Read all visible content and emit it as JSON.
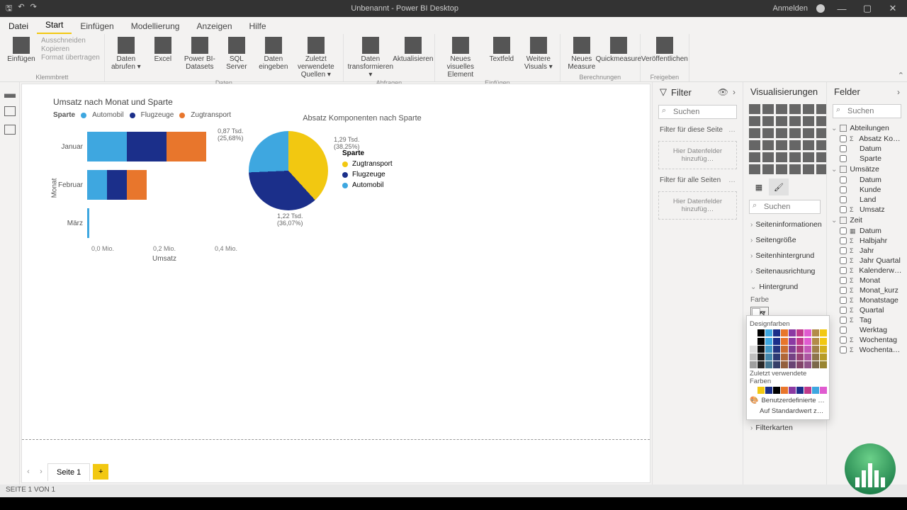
{
  "window": {
    "title": "Unbenannt - Power BI Desktop",
    "signin": "Anmelden"
  },
  "tabs": {
    "file": "Datei",
    "items": [
      "Start",
      "Einfügen",
      "Modellierung",
      "Anzeigen",
      "Hilfe"
    ],
    "active": 0
  },
  "ribbon": {
    "clipboard": {
      "label": "Klemmbrett",
      "paste": "Einfügen",
      "cut": "Ausschneiden",
      "copy": "Kopieren",
      "format": "Format übertragen"
    },
    "data": {
      "label": "Daten",
      "items": [
        "Daten abrufen ▾",
        "Excel",
        "Power BI-Datasets",
        "SQL Server",
        "Daten eingeben",
        "Zuletzt verwendete Quellen ▾"
      ]
    },
    "queries": {
      "label": "Abfragen",
      "items": [
        "Daten transformieren ▾",
        "Aktualisieren"
      ]
    },
    "insert": {
      "label": "Einfügen",
      "items": [
        "Neues visuelles Element",
        "Textfeld",
        "Weitere Visuals ▾"
      ]
    },
    "calc": {
      "label": "Berechnungen",
      "items": [
        "Neues Measure",
        "Quickmeasure"
      ]
    },
    "share": {
      "label": "Freigeben",
      "items": [
        "Veröffentlichen"
      ]
    }
  },
  "chart_data": [
    {
      "type": "stacked-bar",
      "title": "Umsatz nach Monat und Sparte",
      "legend_title": "Sparte",
      "xlabel": "Umsatz",
      "ylabel": "Monat",
      "xticks": [
        "0,0 Mio.",
        "0,2 Mio.",
        "0,4 Mio."
      ],
      "categories": [
        "Januar",
        "Februar",
        "März"
      ],
      "series": [
        {
          "name": "Automobil",
          "color": "#3ea7e0",
          "values": [
            0.12,
            0.05,
            0.01
          ]
        },
        {
          "name": "Flugzeuge",
          "color": "#1b2f8a",
          "values": [
            0.12,
            0.05,
            0.0
          ]
        },
        {
          "name": "Zugtransport",
          "color": "#e8762c",
          "values": [
            0.12,
            0.05,
            0.0
          ]
        }
      ]
    },
    {
      "type": "pie",
      "title": "Absatz Komponenten nach Sparte",
      "legend_title": "Sparte",
      "series": [
        {
          "name": "Zugtransport",
          "color": "#f2c811",
          "value": 1290,
          "label": "1,29 Tsd.",
          "pct": "(38,25%)"
        },
        {
          "name": "Flugzeuge",
          "color": "#1b2f8a",
          "value": 1220,
          "label": "1,22 Tsd.",
          "pct": "(36,07%)"
        },
        {
          "name": "Automobil",
          "color": "#3ea7e0",
          "value": 870,
          "label": "0,87 Tsd.",
          "pct": "(25,68%)"
        }
      ]
    }
  ],
  "pages": {
    "current": "Seite 1"
  },
  "filter": {
    "title": "Filter",
    "search": "Suchen",
    "page_label": "Filter für diese Seite",
    "all_label": "Filter für alle Seiten",
    "drop": "Hier Datenfelder hinzufüg…"
  },
  "vizpane": {
    "title": "Visualisierungen",
    "search": "Suchen",
    "sections": [
      "Seiteninformationen",
      "Seitengröße",
      "Seitenhintergrund",
      "Seitenausrichtung",
      "Hintergrund"
    ],
    "color_label": "Farbe",
    "filter_cards": "Filterkarten",
    "popup": {
      "theme": "Designfarben",
      "recent": "Zuletzt verwendete Farben",
      "custom": "Benutzerdefinierte …",
      "reset": "Auf Standardwert zurü…",
      "theme_colors": [
        "#ffffff",
        "#000000",
        "#3ea7e0",
        "#1b2f8a",
        "#e8762c",
        "#8b3aa3",
        "#c03a8b",
        "#e05bd0",
        "#b38b4a",
        "#f2c811"
      ],
      "recent_colors": [
        "#ffffff",
        "#f2c811",
        "#1b2f8a",
        "#000000",
        "#e8762c",
        "#8b3aa3",
        "#1b2f8a",
        "#c03a8b",
        "#3ea7e0",
        "#e05bd0"
      ]
    }
  },
  "fields": {
    "title": "Felder",
    "search": "Suchen",
    "tables": [
      {
        "name": "Abteilungen",
        "fields": [
          {
            "n": "Absatz Kom…",
            "t": "Σ"
          },
          {
            "n": "Datum",
            "t": ""
          },
          {
            "n": "Sparte",
            "t": ""
          }
        ]
      },
      {
        "name": "Umsätze",
        "fields": [
          {
            "n": "Datum",
            "t": ""
          },
          {
            "n": "Kunde",
            "t": ""
          },
          {
            "n": "Land",
            "t": ""
          },
          {
            "n": "Umsatz",
            "t": "Σ"
          }
        ]
      },
      {
        "name": "Zeit",
        "fields": [
          {
            "n": "Datum",
            "t": "▦"
          },
          {
            "n": "Halbjahr",
            "t": "Σ"
          },
          {
            "n": "Jahr",
            "t": "Σ"
          },
          {
            "n": "Jahr Quartal",
            "t": "Σ"
          },
          {
            "n": "Kalenderwo…",
            "t": "Σ"
          },
          {
            "n": "Monat",
            "t": "Σ"
          },
          {
            "n": "Monat_kurz",
            "t": "Σ"
          },
          {
            "n": "Monatstage",
            "t": "Σ"
          },
          {
            "n": "Quartal",
            "t": "Σ"
          },
          {
            "n": "Tag",
            "t": "Σ"
          },
          {
            "n": "Werktag",
            "t": ""
          },
          {
            "n": "Wochentag",
            "t": "Σ"
          },
          {
            "n": "Wochentag…",
            "t": "Σ"
          }
        ]
      }
    ]
  },
  "status": "SEITE 1 VON 1"
}
